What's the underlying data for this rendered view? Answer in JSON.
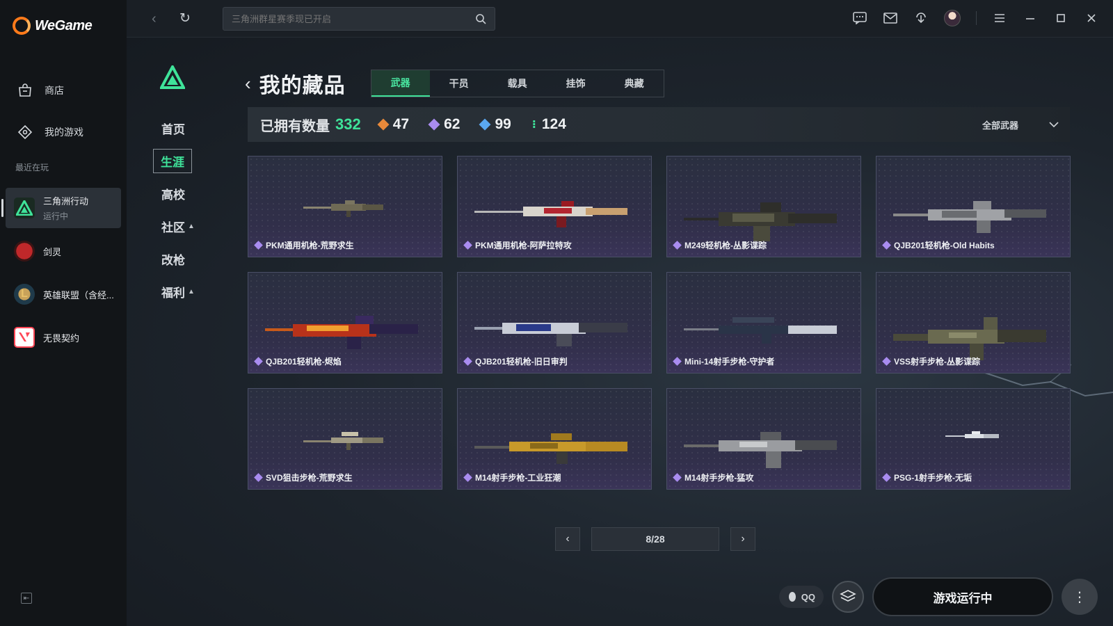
{
  "app": {
    "name": "WeGame",
    "nav": [
      {
        "label": "商店",
        "icon": "bag-icon"
      },
      {
        "label": "我的游戏",
        "icon": "gamepad-icon"
      }
    ],
    "recent_label": "最近在玩",
    "recent": [
      {
        "name": "三角洲行动",
        "status": "运行中",
        "icon": "delta-force-icon",
        "active": true
      },
      {
        "name": "剑灵",
        "status": "",
        "icon": "blade-soul-icon",
        "active": false
      },
      {
        "name": "英雄联盟（含经...",
        "status": "",
        "icon": "lol-icon",
        "active": false
      },
      {
        "name": "无畏契约",
        "status": "",
        "icon": "valorant-icon",
        "active": false
      }
    ]
  },
  "topbar": {
    "search_placeholder": "三角洲群星赛季现已开启"
  },
  "game_nav": [
    {
      "label": "首页",
      "caret": false,
      "active": false
    },
    {
      "label": "生涯",
      "caret": false,
      "active": true
    },
    {
      "label": "高校",
      "caret": false,
      "active": false
    },
    {
      "label": "社区",
      "caret": true,
      "active": false
    },
    {
      "label": "改枪",
      "caret": false,
      "active": false
    },
    {
      "label": "福利",
      "caret": true,
      "active": false
    }
  ],
  "page": {
    "title": "我的藏品",
    "tabs": [
      "武器",
      "干员",
      "载具",
      "挂饰",
      "典藏"
    ],
    "active_tab": 0
  },
  "stats": {
    "owned_label": "已拥有数量",
    "owned_count": "332",
    "rarities": [
      {
        "count": "47",
        "color": "#e8893a"
      },
      {
        "count": "62",
        "color": "#a98cf0"
      },
      {
        "count": "99",
        "color": "#5aa8f0"
      },
      {
        "count": "124",
        "color": "#3fe39a"
      }
    ],
    "filter_label": "全部武器"
  },
  "items": [
    {
      "name": "PKM通用机枪-荒野求生",
      "weapon": "camo-mg"
    },
    {
      "name": "PKM通用机枪-阿萨拉特攻",
      "weapon": "red-mg"
    },
    {
      "name": "M249轻机枪-丛影谍踪",
      "weapon": "dark-lmg"
    },
    {
      "name": "QJB201轻机枪-Old Habits",
      "weapon": "gray-lmg"
    },
    {
      "name": "QJB201轻机枪-烬焰",
      "weapon": "flame-lmg"
    },
    {
      "name": "QJB201轻机枪-旧日审判",
      "weapon": "blue-lmg"
    },
    {
      "name": "Mini-14射手步枪-守护者",
      "weapon": "blue-rifle"
    },
    {
      "name": "VSS射手步枪-丛影谍踪",
      "weapon": "camo-vss"
    },
    {
      "name": "SVD狙击步枪-荒野求生",
      "weapon": "camo-svd"
    },
    {
      "name": "M14射手步枪-工业狂潮",
      "weapon": "gold-m14"
    },
    {
      "name": "M14射手步枪-猛攻",
      "weapon": "silver-m14"
    },
    {
      "name": "PSG-1射手步枪-无垢",
      "weapon": "white-psg"
    }
  ],
  "pager": {
    "label": "8/28"
  },
  "bottom": {
    "qq_label": "QQ",
    "launch_label": "游戏运行中"
  }
}
